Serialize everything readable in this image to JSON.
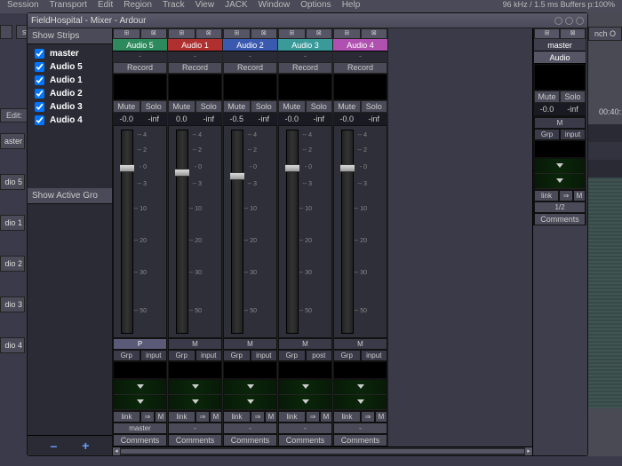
{
  "menubar": {
    "items": [
      "Session",
      "Transport",
      "Edit",
      "Region",
      "Track",
      "View",
      "JACK",
      "Window",
      "Options",
      "Help"
    ],
    "status": "96 kHz / 1.5 ms Buffers p:100%"
  },
  "topctx": {
    "left1": "",
    "left2": "sto",
    "edit": "Edit:",
    "nchO": "nch O"
  },
  "leftlabels": [
    "aster",
    "dio 5",
    "dio 1",
    "dio 2",
    "dio 3",
    "dio 4"
  ],
  "window": {
    "title": "FieldHospital - Mixer - Ardour"
  },
  "sidebar": {
    "show_strips": "Show Strips",
    "items": [
      {
        "label": "master",
        "bold": true
      },
      {
        "label": "Audio 5",
        "bold": true
      },
      {
        "label": "Audio 1",
        "bold": true
      },
      {
        "label": "Audio 2",
        "bold": true
      },
      {
        "label": "Audio 3",
        "bold": true
      },
      {
        "label": "Audio 4",
        "bold": true
      }
    ],
    "groups": "Show  Active  Gro",
    "minus": "–",
    "plus": "+"
  },
  "labels": {
    "record": "Record",
    "mute": "Mute",
    "solo": "Solo",
    "grp": "Grp",
    "input": "input",
    "post": "post",
    "link": "link",
    "m": "M",
    "p": "P",
    "arrow": "⇒",
    "comments": "Comments",
    "dash": "-",
    "tb1": "⊞",
    "tb2": "⊠"
  },
  "scale_ticks": [
    {
      "v": "-- 4",
      "pct": 3
    },
    {
      "v": "-- 2",
      "pct": 10
    },
    {
      "v": "- 0",
      "pct": 18
    },
    {
      "v": "-- 3",
      "pct": 26
    },
    {
      "v": "-- 10",
      "pct": 38
    },
    {
      "v": "-- 20",
      "pct": 53
    },
    {
      "v": "-- 30",
      "pct": 68
    },
    {
      "v": "-- 50",
      "pct": 86
    }
  ],
  "strips": [
    {
      "name": "Audio 5",
      "color": "c-green",
      "gain": "-0.0",
      "peak": "-inf",
      "route": "P",
      "out": "master",
      "knob": 18
    },
    {
      "name": "Audio 1",
      "color": "c-red",
      "gain": "0.0",
      "peak": "-inf",
      "route": "M",
      "out": "-",
      "knob": 20
    },
    {
      "name": "Audio 2",
      "color": "c-blue",
      "gain": "-0.5",
      "peak": "-inf",
      "route": "M",
      "out": "-",
      "knob": 22
    },
    {
      "name": "Audio 3",
      "color": "c-teal",
      "gain": "-0.0",
      "peak": "-inf",
      "route": "M",
      "out": "-",
      "knob": 18,
      "post": true
    },
    {
      "name": "Audio 4",
      "color": "c-mag",
      "gain": "-0.0",
      "peak": "-inf",
      "route": "M",
      "out": "-",
      "knob": 18
    }
  ],
  "master": {
    "name": "master",
    "audio": "Audio",
    "gain": "-0.0",
    "peak": "-inf",
    "route": "M",
    "out": "1/2",
    "knob": 18
  },
  "timeline": {
    "tc": "00:40:"
  }
}
